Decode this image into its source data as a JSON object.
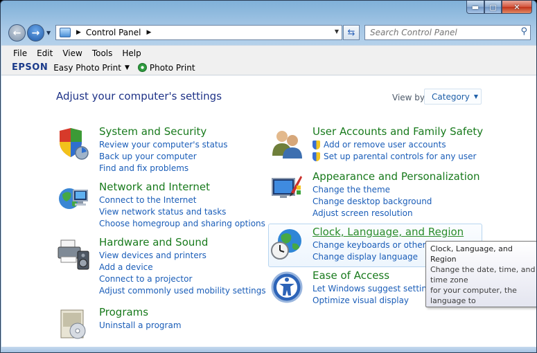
{
  "window": {
    "caption_buttons": {
      "minimize": "minimize-icon",
      "maximize": "maximize-icon",
      "close": "close-icon"
    }
  },
  "nav": {
    "address_path": "Control Panel",
    "search_placeholder": "Search Control Panel"
  },
  "menu": [
    "File",
    "Edit",
    "View",
    "Tools",
    "Help"
  ],
  "epson_toolbar": {
    "brand": "EPSON",
    "easy_photo_print": "Easy Photo Print",
    "photo_print": "Photo Print"
  },
  "content": {
    "heading": "Adjust your computer's settings",
    "view_by_label": "View by:",
    "view_by_value": "Category",
    "categories": [
      {
        "title": "System and Security",
        "links": [
          "Review your computer's status",
          "Back up your computer",
          "Find and fix problems"
        ]
      },
      {
        "title": "Network and Internet",
        "links": [
          "Connect to the Internet",
          "View network status and tasks",
          "Choose homegroup and sharing options"
        ]
      },
      {
        "title": "Hardware and Sound",
        "links": [
          "View devices and printers",
          "Add a device",
          "Connect to a projector",
          "Adjust commonly used mobility settings"
        ]
      },
      {
        "title": "Programs",
        "links": [
          "Uninstall a program"
        ]
      },
      {
        "title": "User Accounts and Family Safety",
        "links": [
          "Add or remove user accounts",
          "Set up parental controls for any user"
        ]
      },
      {
        "title": "Appearance and Personalization",
        "links": [
          "Change the theme",
          "Change desktop background",
          "Adjust screen resolution"
        ]
      },
      {
        "title": "Clock, Language, and Region",
        "links": [
          "Change keyboards or other input methods",
          "Change display language"
        ]
      },
      {
        "title": "Ease of Access",
        "links": [
          "Let Windows suggest settings",
          "Optimize visual display"
        ]
      }
    ]
  },
  "tooltip": {
    "title": "Clock, Language, and Region",
    "body": "Change the date, time, and time zone\nfor your computer, the language to\nuse, and the way numbers,\ncurrencies, dates, and times are\ndisplayed."
  },
  "colors": {
    "category_title": "#187a1c",
    "link": "#1a5db8",
    "heading": "#1e3287"
  }
}
